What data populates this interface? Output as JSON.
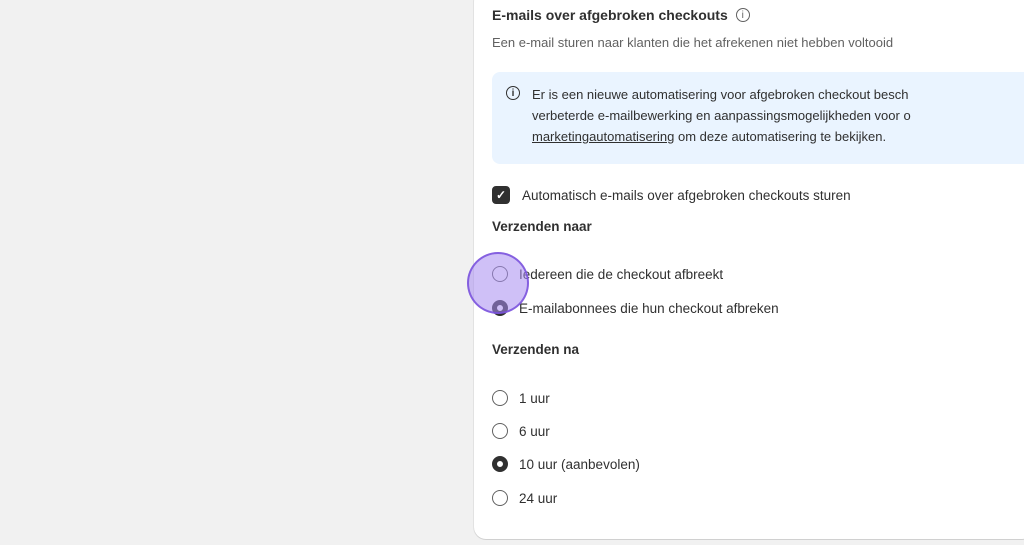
{
  "section": {
    "title": "E-mails over afgebroken checkouts",
    "info_icon": "info-icon",
    "subtitle": "Een e-mail sturen naar klanten die het afrekenen niet hebben voltooid"
  },
  "banner": {
    "icon": "info-icon",
    "line1": "Er is een nieuwe automatisering voor afgebroken checkout besch",
    "line2": "verbeterde e-mailbewerking en aanpassingsmogelijkheden voor o",
    "link": "marketingautomatisering",
    "line3_rest": " om deze automatisering te bekijken."
  },
  "auto_send": {
    "label": "Automatisch e-mails over afgebroken checkouts sturen",
    "checked": true
  },
  "send_to": {
    "label": "Verzenden naar",
    "options": [
      {
        "label": "Iedereen die de checkout afbreekt",
        "checked": false
      },
      {
        "label": "E-mailabonnees die hun checkout afbreken",
        "checked": true
      }
    ]
  },
  "send_after": {
    "label": "Verzenden na",
    "options": [
      {
        "label": "1 uur",
        "checked": false
      },
      {
        "label": "6 uur",
        "checked": false
      },
      {
        "label": "10 uur (aanbevolen)",
        "checked": true
      },
      {
        "label": "24 uur",
        "checked": false
      }
    ]
  },
  "colors": {
    "banner_bg": "#eaf4ff",
    "cursor_highlight": "#a88cf0"
  }
}
